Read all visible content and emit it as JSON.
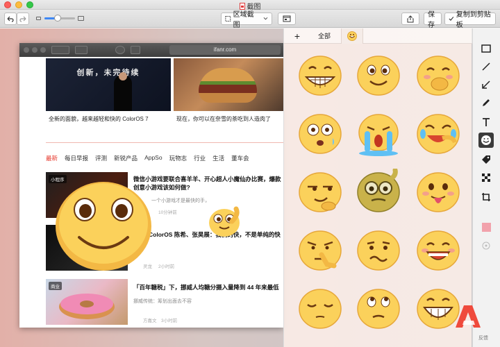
{
  "window": {
    "title": "截图"
  },
  "toolbar": {
    "region_mode": "区域截图",
    "save_label": "保存",
    "copy_label": "复制到剪贴板"
  },
  "browser": {
    "url": "ifanr.com",
    "hero_slogan": "创新，未完待续",
    "hero1_caption": "全新的面貌，越来越轻和快的 ColorOS 7",
    "hero2_caption": "现在，你可以在奈雪的茶吃到人造肉了",
    "nav": [
      "最新",
      "每日早报",
      "评测",
      "新锐产品",
      "AppSo",
      "玩物志",
      "行业",
      "生活",
      "董车会"
    ],
    "articles": [
      {
        "tag": "小程序",
        "title": "微信小游戏要联合喜羊羊、开心超人小魔仙办比赛，爆款创意小游戏该如何做?",
        "sub": "一个小游戏才是最快的手，",
        "author": "",
        "time": "10分钟前"
      },
      {
        "tag": "",
        "title": "ColorOS 陈希、张昊展：我们的快，不是单纯的快",
        "sub": "",
        "author": "灵龙",
        "time": "2小时前"
      },
      {
        "tag": "商业",
        "title": "「百年糖税」下，挪威人均糖分摄入量降到 44 年来最低",
        "sub": "挪威传统：筹划出面去不容",
        "author": "方嘉文",
        "time": "3小时前"
      }
    ]
  },
  "panel": {
    "tabs": [
      {
        "label": "+"
      },
      {
        "label": "全部"
      },
      {
        "label": "emoji"
      }
    ]
  },
  "rail": {
    "tools": [
      "rectangle-icon",
      "line-icon",
      "arrow-icon",
      "pen-icon",
      "text-icon",
      "emoji-icon",
      "tag-icon",
      "mosaic-icon",
      "crop-icon",
      "color-swatch-icon",
      "size-dot-icon"
    ],
    "feedback": "反馈",
    "swatch_color": "#f2a2ac"
  },
  "colors": {
    "accent": "#3d87f5",
    "emoji_yellow": "#fbd15b",
    "brand_red": "#e6372b"
  }
}
